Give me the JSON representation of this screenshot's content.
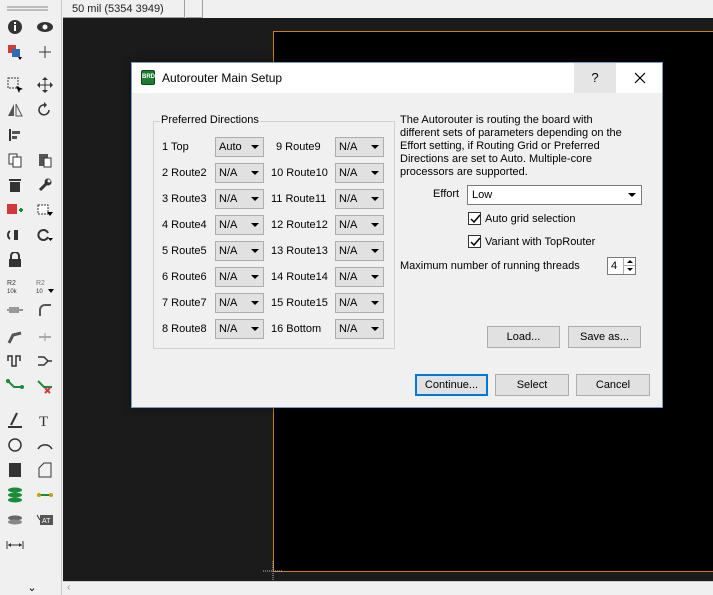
{
  "statusbar": {
    "coordinates": "50 mil (5354 3949)"
  },
  "dialog": {
    "title": "Autorouter Main Setup",
    "help_label": "?",
    "preferred_directions_title": "Preferred Directions",
    "layers": [
      {
        "label": "1  Top",
        "value": "Auto"
      },
      {
        "label": "2  Route2",
        "value": "N/A"
      },
      {
        "label": "3  Route3",
        "value": "N/A"
      },
      {
        "label": "4  Route4",
        "value": "N/A"
      },
      {
        "label": "5  Route5",
        "value": "N/A"
      },
      {
        "label": "6  Route6",
        "value": "N/A"
      },
      {
        "label": "7  Route7",
        "value": "N/A"
      },
      {
        "label": "8  Route8",
        "value": "N/A"
      },
      {
        "label": "9  Route9",
        "value": "N/A"
      },
      {
        "label": "10  Route10",
        "value": "N/A"
      },
      {
        "label": "11  Route11",
        "value": "N/A"
      },
      {
        "label": "12  Route12",
        "value": "N/A"
      },
      {
        "label": "13  Route13",
        "value": "N/A"
      },
      {
        "label": "14  Route14",
        "value": "N/A"
      },
      {
        "label": "15  Route15",
        "value": "N/A"
      },
      {
        "label": "16  Bottom",
        "value": "N/A"
      }
    ],
    "info_text": "The Autorouter is routing the board with different sets of parameters depending on the Effort setting, if Routing Grid or Preferred Directions are set to Auto. Multiple-core processors are supported.",
    "effort_label": "Effort",
    "effort_value": "Low",
    "auto_grid_label": "Auto grid selection",
    "auto_grid_checked": true,
    "variant_label": "Variant with TopRouter",
    "variant_checked": true,
    "threads_label": "Maximum number of running threads",
    "threads_value": "4",
    "load_label": "Load...",
    "save_as_label": "Save as...",
    "continue_label": "Continue...",
    "select_label": "Select",
    "cancel_label": "Cancel"
  },
  "toolbar": {
    "tools": [
      "info",
      "show",
      "layers",
      "mark",
      "select",
      "move",
      "mirror",
      "rotate",
      "align",
      "copy",
      "paste",
      "delete",
      "properties",
      "add-part",
      "replace",
      "swap",
      "change",
      "lock",
      "smash",
      "value",
      "name",
      "miter",
      "split",
      "optimize",
      "route",
      "meander",
      "ripup",
      "route-diff",
      "autorouter-fanout",
      "line",
      "text",
      "circle",
      "arc",
      "rect",
      "polygon",
      "via",
      "signal",
      "hole",
      "attribute",
      "dimension"
    ],
    "more_label": "⌄",
    "colors": {
      "accent_green": "#1d8a3a",
      "accent_red": "#d23a3a",
      "accent_blue": "#2a6db5"
    }
  }
}
